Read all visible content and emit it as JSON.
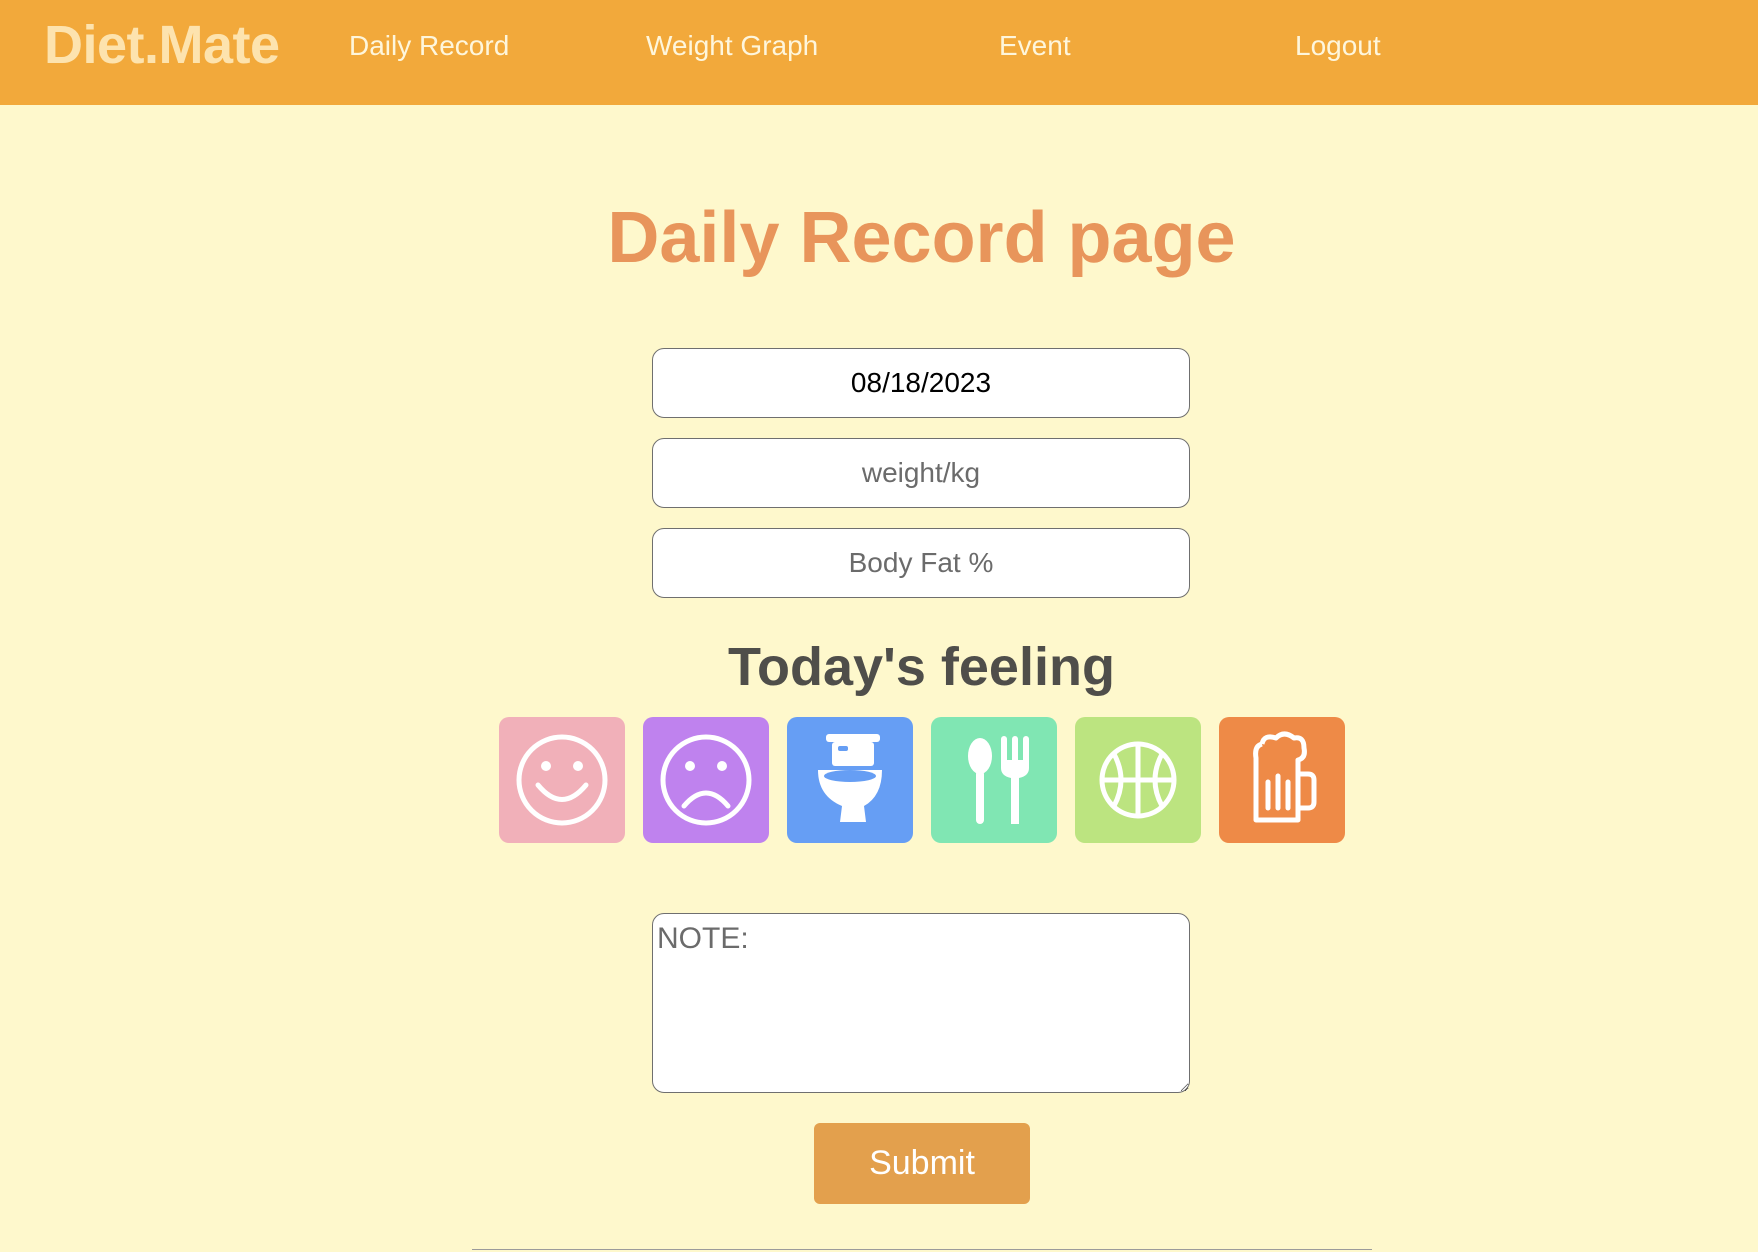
{
  "navbar": {
    "brand": "Diet.Mate",
    "links": [
      "Daily Record",
      "Weight Graph",
      "Event",
      "Logout"
    ],
    "background": "#f2a93b"
  },
  "main": {
    "title": "Daily Record page",
    "date_value": "08/18/2023",
    "weight_placeholder": "weight/kg",
    "bodyfat_placeholder": "Body Fat %",
    "feeling_title": "Today's feeling",
    "feelings": [
      {
        "icon": "smiley-face-icon",
        "color": "#f1b0b9"
      },
      {
        "icon": "sad-face-icon",
        "color": "#bf82ee"
      },
      {
        "icon": "toilet-icon",
        "color": "#669ef4"
      },
      {
        "icon": "utensils-icon",
        "color": "#80e6b3"
      },
      {
        "icon": "basketball-icon",
        "color": "#bce480"
      },
      {
        "icon": "beer-mug-icon",
        "color": "#ee8a47"
      }
    ],
    "note_placeholder": "NOTE:",
    "submit_label": "Submit"
  },
  "colors": {
    "page_bg": "#fef8cc",
    "title": "#e8955b",
    "submit": "#e3a04d"
  }
}
